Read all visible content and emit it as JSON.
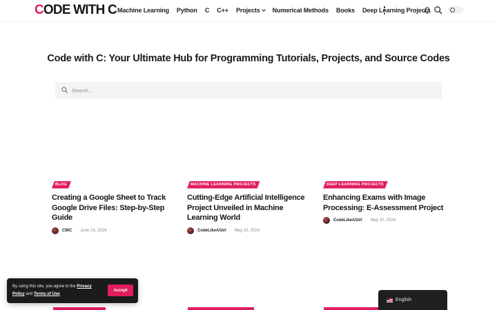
{
  "header": {
    "logo_first": "C",
    "logo_rest": "ODE WITH C",
    "nav": [
      {
        "label": "Machine Learning",
        "dropdown": false
      },
      {
        "label": "Python",
        "dropdown": false
      },
      {
        "label": "C",
        "dropdown": false
      },
      {
        "label": "C++",
        "dropdown": false
      },
      {
        "label": "Projects",
        "dropdown": true
      },
      {
        "label": "Numerical Methods",
        "dropdown": false
      },
      {
        "label": "Books",
        "dropdown": false
      },
      {
        "label": "Deep Learning Projects",
        "dropdown": false
      }
    ],
    "icons": [
      "more-vertical-icon",
      "bell-icon",
      "search-icon",
      "sun-icon"
    ]
  },
  "hero": {
    "title": "Code with C: Your Ultimate Hub for Programming Tutorials, Projects, and Source Codes ",
    "search_placeholder": "Search..."
  },
  "cards": [
    {
      "category": "BLOG",
      "title": "Creating a Google Sheet to Track Google Drive Files: Step-by-Step Guide",
      "author": "CWC",
      "date": "June 23, 2024"
    },
    {
      "category": "MACHINE LEARNING PROJECTS",
      "title": "Cutting-Edge Artificial Intelligence Project Unveiled in Machine Learning World",
      "author": "CodeLikeAGirl",
      "date": "May 10, 2024"
    },
    {
      "category": "DEEP LEARNING PROJECTS",
      "title": "Enhancing Exams with Image Processing: E-Assessment Project",
      "author": "CodeLikeAGirl",
      "date": "May 10, 2024"
    }
  ],
  "cookie": {
    "text_before": "By using this site, you agree to the ",
    "privacy_label": "Privacy Policy",
    "and_text": " and ",
    "terms_label": "Terms of Use",
    "period": ".",
    "accept_label": "Accept"
  },
  "language": {
    "label": "English"
  },
  "colors": {
    "accent": "#e11d5c",
    "dark_panel": "#1b1b1d"
  }
}
